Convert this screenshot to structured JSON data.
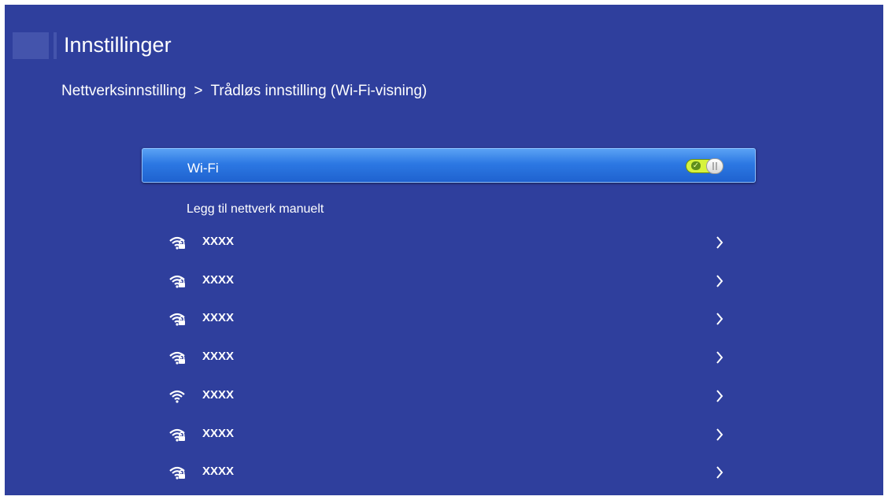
{
  "header": {
    "title": "Innstillinger"
  },
  "breadcrumb": {
    "parent": "Nettverksinnstilling",
    "separator": ">",
    "current": "Trådløs innstilling (Wi-Fi-visning)"
  },
  "wifi": {
    "label": "Wi-Fi",
    "enabled": true,
    "check_glyph": "✓"
  },
  "manual_network": {
    "label": "Legg til nettverk manuelt"
  },
  "networks": [
    {
      "name": "XXXX",
      "icon": "wifi-lock-icon"
    },
    {
      "name": "XXXX",
      "icon": "wifi-lock-icon"
    },
    {
      "name": "XXXX",
      "icon": "wifi-lock-icon"
    },
    {
      "name": "XXXX",
      "icon": "wifi-lock-icon"
    },
    {
      "name": "XXXX",
      "icon": "wifi-icon"
    },
    {
      "name": "XXXX",
      "icon": "wifi-lock-icon"
    },
    {
      "name": "XXXX",
      "icon": "wifi-lock-icon"
    }
  ],
  "colors": {
    "background": "#2f3f9d",
    "highlight": "#2c78e3",
    "toggle_on": "#d7f33d",
    "text": "#ffffff"
  }
}
